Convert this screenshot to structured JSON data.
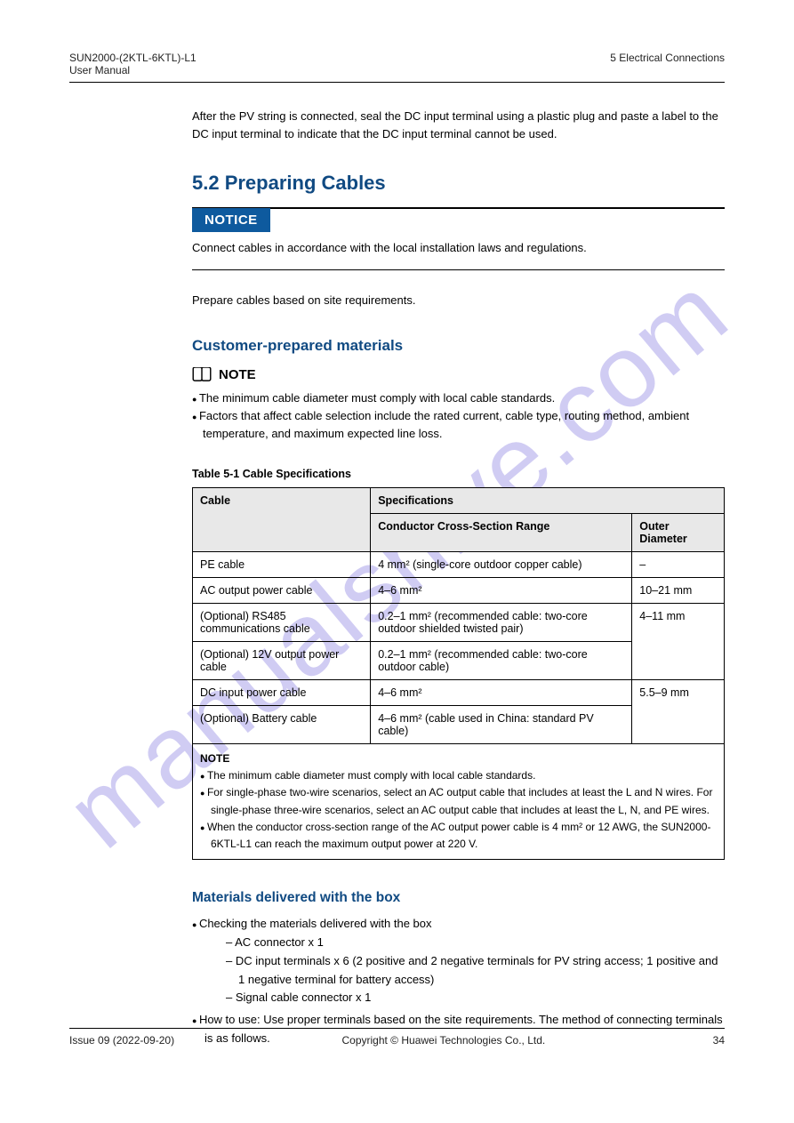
{
  "header": {
    "left": "SUN2000-(2KTL-6KTL)-L1",
    "center": "User Manual",
    "right": "5 Electrical Connections"
  },
  "intro": "After the PV string is connected, seal the DC input terminal using a plastic plug and paste a label to the DC input terminal to indicate that the DC input terminal cannot be used.",
  "section_title": "5.2 Preparing Cables",
  "notice": {
    "badge": "NOTICE",
    "text": "Connect cables in accordance with the local installation laws and regulations."
  },
  "prep_notice": "Prepare cables based on site requirements.",
  "subsection_title": "Customer-prepared materials",
  "note": {
    "label": "NOTE",
    "bullets": [
      "The minimum cable diameter must comply with local cable standards.",
      "Factors that affect cable selection include the rated current, cable type, routing method, ambient temperature, and maximum expected line loss."
    ]
  },
  "table": {
    "caption": "Table 5-1 Cable Specifications",
    "head": [
      "Cable",
      "Specifications"
    ],
    "subhead": [
      "Conductor Cross-Section Range",
      "Outer Diameter"
    ],
    "rows": [
      {
        "cable": "PE cable",
        "spec": "4 mm² (single-core outdoor copper cable)",
        "od": "–"
      },
      {
        "cable": "AC output power cable",
        "spec": "4–6 mm²",
        "od": "10–21 mm"
      },
      {
        "cable": "(Optional) RS485 communications cable",
        "spec": "0.2–1 mm² (recommended cable: two-core outdoor shielded twisted pair)",
        "od": "4–11 mm"
      },
      {
        "cable": "(Optional) 12V output power cable",
        "spec": "0.2–1 mm² (recommended cable: two-core outdoor cable)",
        "od": "4–11 mm"
      },
      {
        "cable": "DC input power cable",
        "spec": "4–6 mm²",
        "od": "5.5–9 mm"
      },
      {
        "cable": "(Optional) Battery cable",
        "spec": "4–6 mm² (cable used in China: standard PV cable)",
        "od": "5.5–9 mm"
      }
    ],
    "note_label": "NOTE",
    "notes": [
      "The minimum cable diameter must comply with local cable standards.",
      "For single-phase two-wire scenarios, select an AC output cable that includes at least the L and N wires. For single-phase three-wire scenarios, select an AC output cable that includes at least the L, N, and PE wires.",
      "When the conductor cross-section range of the AC output power cable is 4 mm² or 12 AWG, the SUN2000-6KTL-L1 can reach the maximum output power at 220 V."
    ]
  },
  "subsection2_title": "Materials delivered with the box",
  "steps": {
    "item1": "Checking the materials delivered with the box",
    "sub_items": [
      "AC connector x 1",
      "DC input terminals x 6 (2 positive and 2 negative terminals for PV string access; 1 positive and 1 negative terminal for battery access)",
      "Signal cable connector x 1"
    ],
    "item2": "How to use: Use proper terminals based on the site requirements. The method of connecting terminals is as follows."
  },
  "footer": {
    "left": "Issue 09 (2022-09-20)",
    "center": "Copyright © Huawei Technologies Co., Ltd.",
    "right": "34"
  },
  "watermark": "manualshive.com"
}
